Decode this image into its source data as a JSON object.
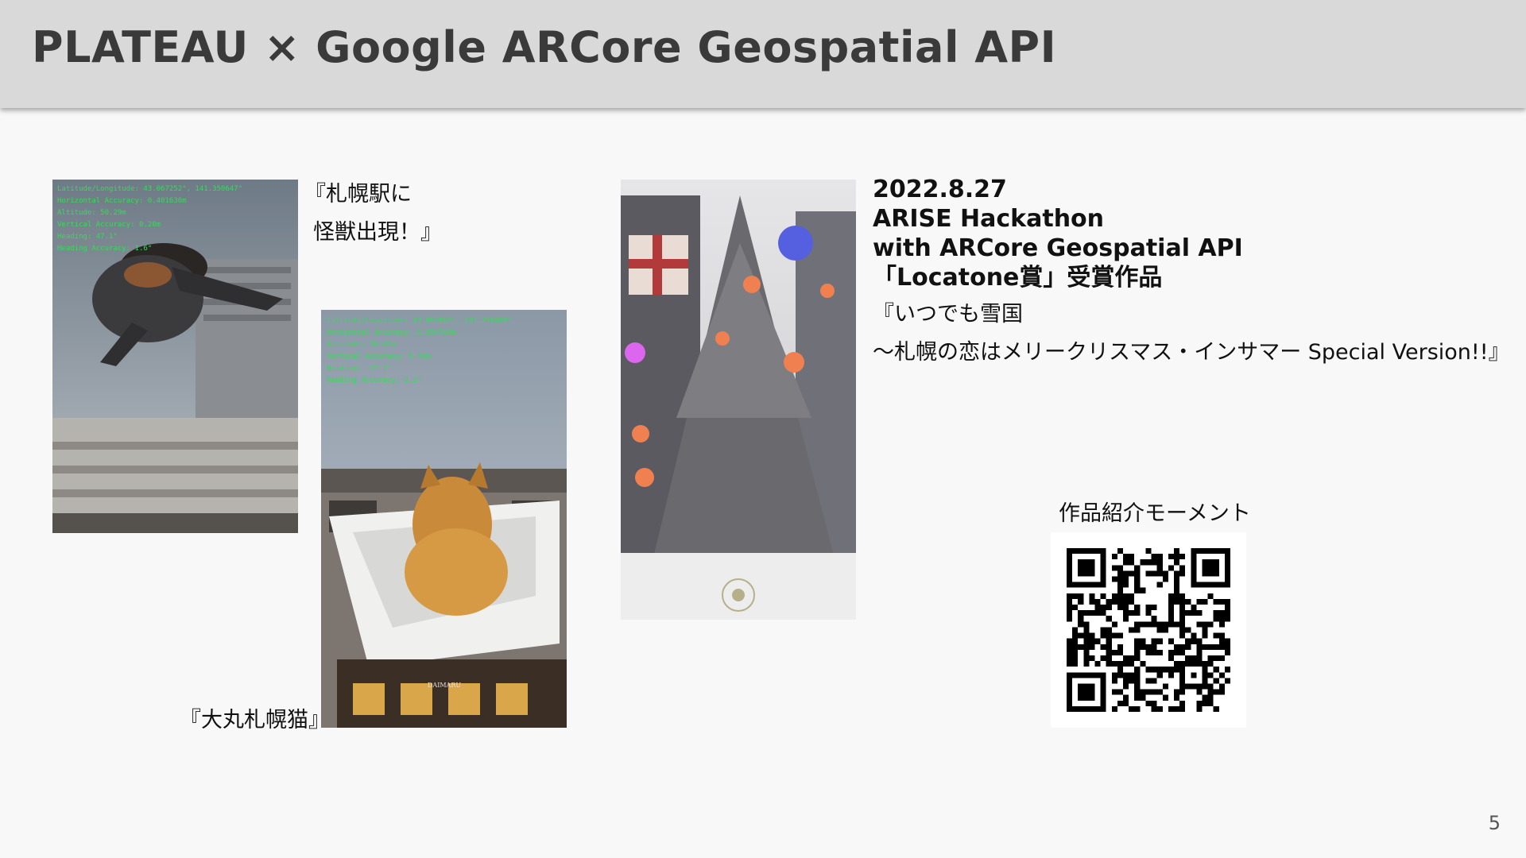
{
  "slide": {
    "title": "PLATEAU × Google ARCore Geospatial API",
    "page_number": "5"
  },
  "photos": {
    "monster": {
      "caption_line1": "『札幌駅に",
      "caption_line2": "怪獣出現！』",
      "overlay": [
        "Latitude/Longitude: 43.067252°, 141.350647°",
        "Horizontal Accuracy: 0.401630m",
        "Altitude: 50.29m",
        "Vertical Accuracy: 0.20m",
        "Heading: 47.1°",
        "Heading Accuracy: 1.6°"
      ]
    },
    "cat": {
      "caption": "『大丸札幌猫』",
      "store_sign": "DAIMARU",
      "overlay": [
        "Latitude/Longitude: 43.067063°, 141.350409°",
        "Horizontal Accuracy: 0.550768m",
        "Altitude: 50.47m",
        "Vertical Accuracy: 0.49m",
        "Heading: -37.1°",
        "Heading Accuracy: 2.2°"
      ]
    }
  },
  "info": {
    "date": "2022.8.27",
    "event": "ARISE Hackathon",
    "with": "with ARCore Geospatial API",
    "award": "「Locatone賞」受賞作品",
    "work_title": "『いつでも雪国",
    "work_subtitle": "～札幌の恋はメリークリスマス・インサマー Special Version!!』"
  },
  "qr": {
    "label": "作品紹介モーメント"
  }
}
